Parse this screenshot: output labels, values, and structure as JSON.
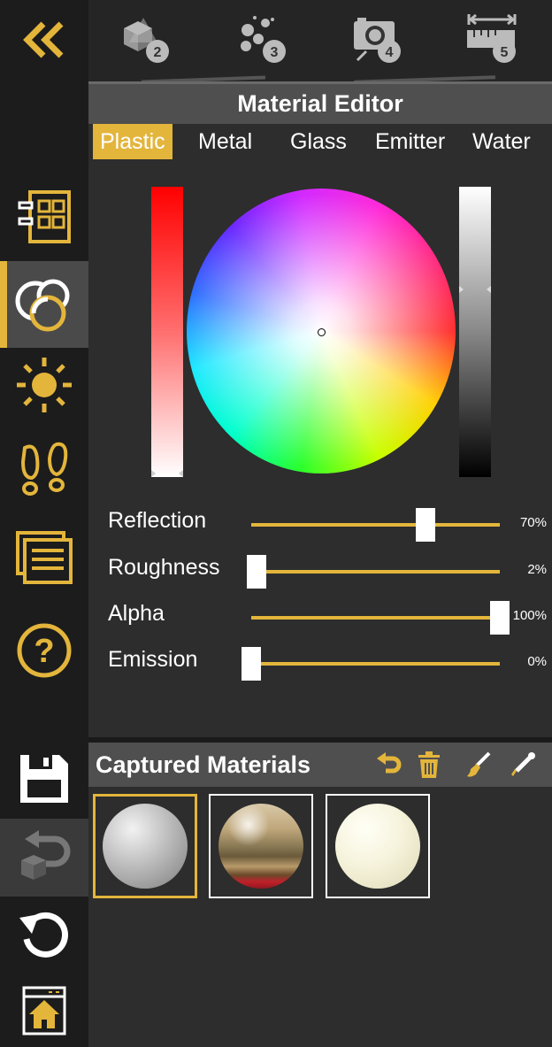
{
  "panel_title": "Material Editor",
  "tabs": [
    "Plastic",
    "Metal",
    "Glass",
    "Emitter",
    "Water"
  ],
  "active_tab": "Plastic",
  "top_tools": [
    {
      "icon": "objects-icon",
      "badge": "2"
    },
    {
      "icon": "path-icon",
      "badge": "3"
    },
    {
      "icon": "camera-icon",
      "badge": "4"
    },
    {
      "icon": "measure-icon",
      "badge": "5"
    }
  ],
  "sidebar_icons": [
    "collapse-icon",
    "layout-icon",
    "materials-icon",
    "light-icon",
    "walk-icon",
    "notes-icon",
    "help-icon",
    "save-icon",
    "undo-box-icon",
    "reset-icon",
    "home-icon"
  ],
  "sliders": [
    {
      "label": "Reflection",
      "value": 70,
      "display": "70%"
    },
    {
      "label": "Roughness",
      "value": 2,
      "display": "2%"
    },
    {
      "label": "Alpha",
      "value": 100,
      "display": "100%"
    },
    {
      "label": "Emission",
      "value": 0,
      "display": "0%"
    }
  ],
  "captured": {
    "title": "Captured Materials",
    "actions": [
      "undo-icon",
      "trash-icon",
      "brush-icon",
      "eyedropper-icon"
    ],
    "materials": [
      {
        "name": "gray-concrete-sphere",
        "selected": true
      },
      {
        "name": "wood-sphere",
        "selected": false
      },
      {
        "name": "cream-sphere",
        "selected": false
      }
    ]
  },
  "colors": {
    "accent": "#e3b53b",
    "panel": "#2d2d2d",
    "sidebar": "#1c1c1c",
    "header": "#4f4f4f"
  }
}
